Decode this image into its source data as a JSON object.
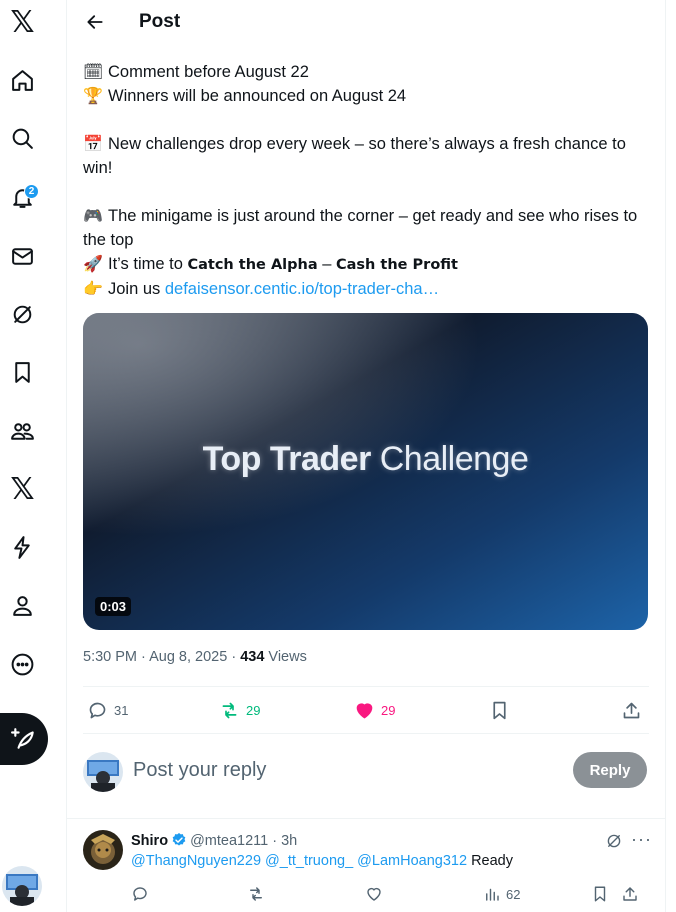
{
  "nav": {
    "logo": "𝕏",
    "notifications_badge": "2",
    "items": [
      "home-icon",
      "search-icon",
      "bell-icon",
      "mail-icon",
      "grok-icon",
      "bookmark-icon",
      "communities-icon",
      "premium-icon",
      "lightning-icon",
      "profile-icon",
      "more-icon"
    ],
    "premium_logo": "𝕏"
  },
  "header": {
    "title": "Post"
  },
  "post": {
    "lines": {
      "l1": "Comment before August 22",
      "l2": "Winners will be announced on August 24",
      "l3": "New challenges drop every week – so there’s always a fresh chance to win!",
      "l4": "The minigame is just around the corner – get ready and see who rises to the top",
      "l5_pre": "It’s time to ",
      "l5_bold1": "Catch the Alpha",
      "l5_mid": " – ",
      "l5_bold2": "Cash the Profit",
      "l6_pre": "Join us ",
      "l6_link": "defaisensor.centic.io/top-trader-cha…"
    },
    "emojis": {
      "calendar": "🗓",
      "trophy": "🏆",
      "calendar2": "📅",
      "gamepad": "🎮",
      "rocket": "🚀",
      "point": "👉"
    },
    "video": {
      "title_strong": "Top Trader",
      "title_rest": " Challenge",
      "duration": "0:03"
    },
    "meta": {
      "time": "5:30 PM · Aug 8, 2025 · ",
      "views_count": "434",
      "views_label": " Views"
    },
    "stats": {
      "replies": "31",
      "reposts": "29",
      "likes": "29"
    }
  },
  "reply_composer": {
    "placeholder": "Post your reply",
    "button": "Reply"
  },
  "replies": [
    {
      "name": "Shiro",
      "handle": "@mtea1211 · 3h",
      "mentions": [
        "@ThangNguyen229",
        "@_tt_truong_",
        "@LamHoang312"
      ],
      "text": "Ready",
      "views": "62"
    }
  ],
  "colors": {
    "accent": "#1d9bf0",
    "repost": "#00ba7c",
    "like": "#f91880",
    "muted": "#536471"
  }
}
